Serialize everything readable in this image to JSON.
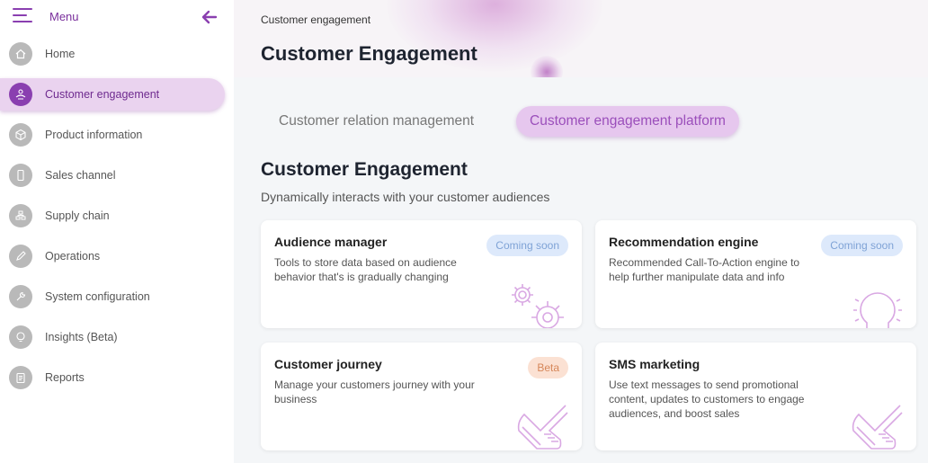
{
  "sidebar": {
    "menu_label": "Menu",
    "items": [
      {
        "label": "Home",
        "icon": "home-icon"
      },
      {
        "label": "Customer engagement",
        "icon": "engagement-icon"
      },
      {
        "label": "Product information",
        "icon": "product-icon"
      },
      {
        "label": "Sales channel",
        "icon": "phone-icon"
      },
      {
        "label": "Supply chain",
        "icon": "supply-icon"
      },
      {
        "label": "Operations",
        "icon": "pen-icon"
      },
      {
        "label": "System configuration",
        "icon": "wrench-icon"
      },
      {
        "label": "Insights (Beta)",
        "icon": "bulb-icon"
      },
      {
        "label": "Reports",
        "icon": "clipboard-icon"
      }
    ],
    "active_index": 1
  },
  "header": {
    "breadcrumb": "Customer engagement",
    "title": "Customer Engagement"
  },
  "tabs": [
    {
      "label": "Customer relation management",
      "active": false
    },
    {
      "label": "Customer engagement platform",
      "active": true
    }
  ],
  "section": {
    "title": "Customer Engagement",
    "subtitle": "Dynamically interacts with your customer audiences"
  },
  "cards": [
    {
      "title": "Audience manager",
      "badge": "Coming soon",
      "desc": "Tools to store data based on audience behavior that's is gradually changing",
      "icon": "gears-icon"
    },
    {
      "title": "Recommendation engine",
      "badge": "Coming soon",
      "desc": "Recommended Call-To-Action engine to help further manipulate data and info",
      "icon": "lightbulb-icon"
    },
    {
      "title": "Customer journey",
      "badge": "Beta",
      "desc": "Manage your customers journey with your business",
      "icon": "shoe-icon"
    },
    {
      "title": "SMS marketing",
      "badge": "",
      "desc": "Use text messages to send promotional content, updates to customers to engage audiences, and boost sales",
      "icon": "shoe-icon"
    }
  ],
  "colors": {
    "accent": "#8a3fb0",
    "active_bg": "#ead3ef",
    "badge_soon_bg": "#dde9fb",
    "badge_beta_bg": "#fbe1d3"
  }
}
